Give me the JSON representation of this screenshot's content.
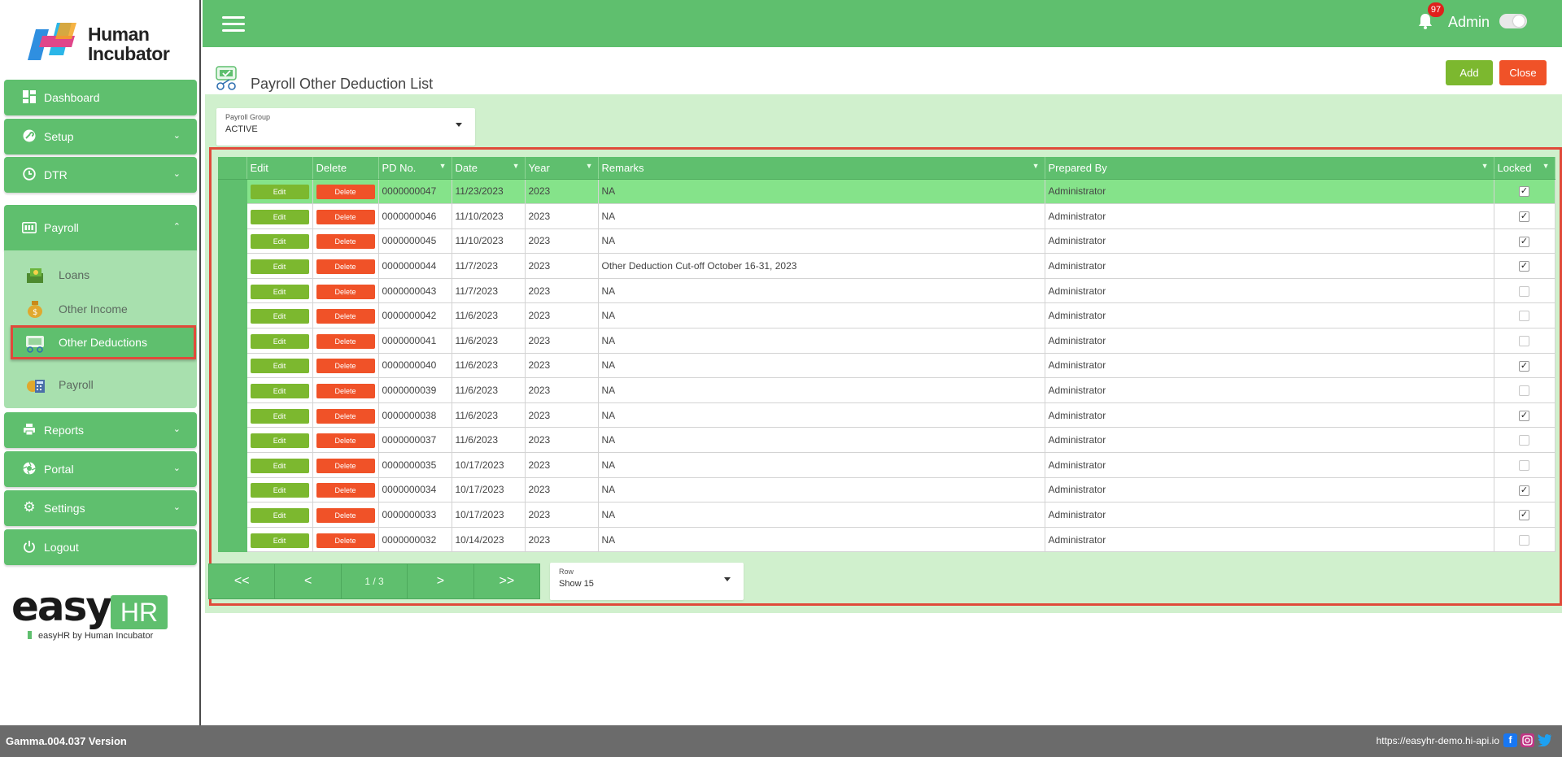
{
  "brand": {
    "name_line1": "Human",
    "name_line2": "Incubator",
    "easy_word": "easy",
    "hr_word": "HR",
    "tagline": "easyHR by Human Incubator"
  },
  "sidebar": {
    "items": [
      {
        "label": "Dashboard",
        "icon": "dashboard-icon"
      },
      {
        "label": "Setup",
        "icon": "wrench-icon"
      },
      {
        "label": "DTR",
        "icon": "clock-icon"
      },
      {
        "label": "Payroll",
        "icon": "payroll-icon"
      },
      {
        "label": "Reports",
        "icon": "printer-icon"
      },
      {
        "label": "Portal",
        "icon": "aperture-icon"
      },
      {
        "label": "Settings",
        "icon": "gear-icon"
      },
      {
        "label": "Logout",
        "icon": "power-icon"
      }
    ],
    "payroll_sub": [
      {
        "label": "Loans",
        "icon": "cash-icon"
      },
      {
        "label": "Other Income",
        "icon": "money-bag-icon"
      },
      {
        "label": "Other Deductions",
        "icon": "deduction-icon"
      },
      {
        "label": "Payroll",
        "icon": "calculator-icon"
      }
    ]
  },
  "header": {
    "notification_count": "97",
    "user": "Admin"
  },
  "page": {
    "title": "Payroll Other Deduction List",
    "add_label": "Add",
    "close_label": "Close"
  },
  "filter": {
    "label": "Payroll Group",
    "value": "ACTIVE"
  },
  "table": {
    "columns": [
      "Edit",
      "Delete",
      "PD No.",
      "Date",
      "Year",
      "Remarks",
      "Prepared By",
      "Locked"
    ],
    "edit_label": "Edit",
    "delete_label": "Delete",
    "rows": [
      {
        "pd": "0000000047",
        "date": "11/23/2023",
        "year": "2023",
        "remarks": "NA",
        "by": "Administrator",
        "locked": true
      },
      {
        "pd": "0000000046",
        "date": "11/10/2023",
        "year": "2023",
        "remarks": "NA",
        "by": "Administrator",
        "locked": true
      },
      {
        "pd": "0000000045",
        "date": "11/10/2023",
        "year": "2023",
        "remarks": "NA",
        "by": "Administrator",
        "locked": true
      },
      {
        "pd": "0000000044",
        "date": "11/7/2023",
        "year": "2023",
        "remarks": "Other Deduction Cut-off October 16-31, 2023",
        "by": "Administrator",
        "locked": true
      },
      {
        "pd": "0000000043",
        "date": "11/7/2023",
        "year": "2023",
        "remarks": "NA",
        "by": "Administrator",
        "locked": false
      },
      {
        "pd": "0000000042",
        "date": "11/6/2023",
        "year": "2023",
        "remarks": "NA",
        "by": "Administrator",
        "locked": false
      },
      {
        "pd": "0000000041",
        "date": "11/6/2023",
        "year": "2023",
        "remarks": "NA",
        "by": "Administrator",
        "locked": false
      },
      {
        "pd": "0000000040",
        "date": "11/6/2023",
        "year": "2023",
        "remarks": "NA",
        "by": "Administrator",
        "locked": true
      },
      {
        "pd": "0000000039",
        "date": "11/6/2023",
        "year": "2023",
        "remarks": "NA",
        "by": "Administrator",
        "locked": false
      },
      {
        "pd": "0000000038",
        "date": "11/6/2023",
        "year": "2023",
        "remarks": "NA",
        "by": "Administrator",
        "locked": true
      },
      {
        "pd": "0000000037",
        "date": "11/6/2023",
        "year": "2023",
        "remarks": "NA",
        "by": "Administrator",
        "locked": false
      },
      {
        "pd": "0000000035",
        "date": "10/17/2023",
        "year": "2023",
        "remarks": "NA",
        "by": "Administrator",
        "locked": false
      },
      {
        "pd": "0000000034",
        "date": "10/17/2023",
        "year": "2023",
        "remarks": "NA",
        "by": "Administrator",
        "locked": true
      },
      {
        "pd": "0000000033",
        "date": "10/17/2023",
        "year": "2023",
        "remarks": "NA",
        "by": "Administrator",
        "locked": true
      },
      {
        "pd": "0000000032",
        "date": "10/14/2023",
        "year": "2023",
        "remarks": "NA",
        "by": "Administrator",
        "locked": false
      }
    ]
  },
  "pager": {
    "first": "<<",
    "prev": "<",
    "page_info": "1 / 3",
    "next": ">",
    "last": ">>"
  },
  "rows_select": {
    "label": "Row",
    "value": "Show 15"
  },
  "footer": {
    "version": "Gamma.004.037 Version",
    "url": "https://easyhr-demo.hi-api.io"
  },
  "colors": {
    "primary_green": "#5fbf6e",
    "panel_green": "#d0f0cd",
    "add_green": "#7cb82f",
    "delete_red": "#f05228",
    "highlight_red": "#e04a3a"
  }
}
